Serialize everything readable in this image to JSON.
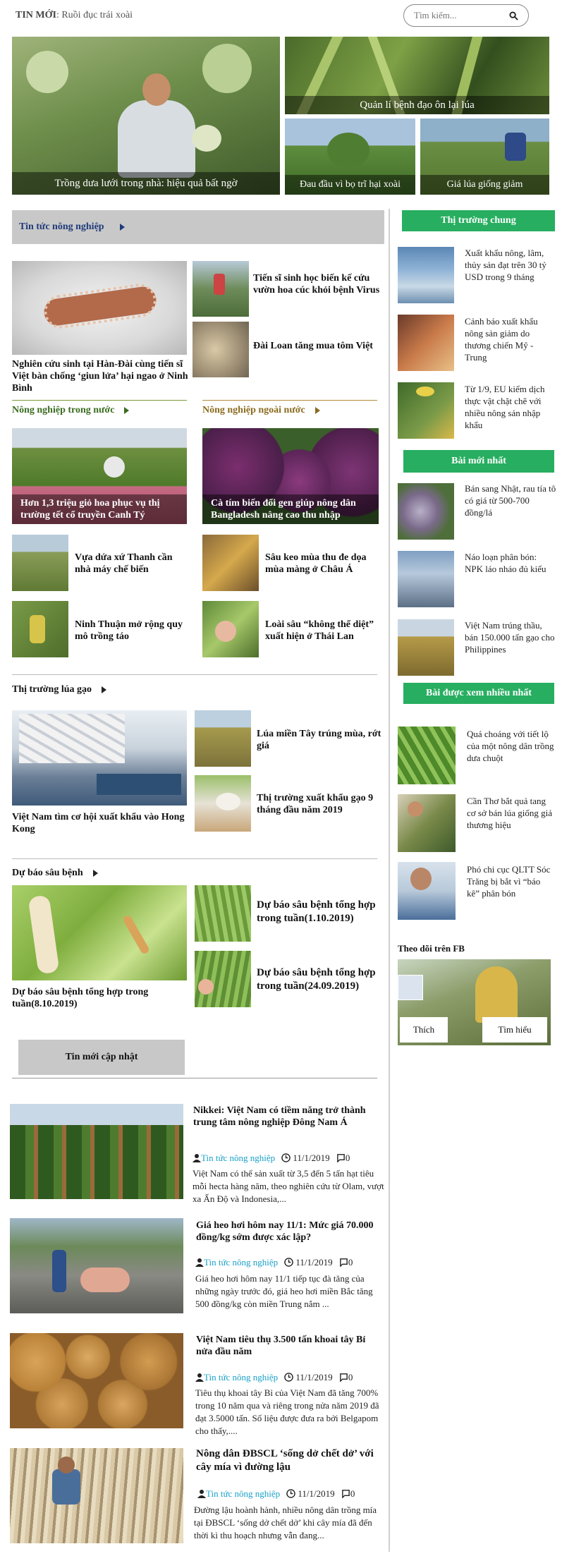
{
  "header": {
    "label": "TIN MỚI",
    "ticker": ": Ruồi đục trái xoài",
    "search_placeholder": "Tìm kiếm..."
  },
  "hero": {
    "main": "Trồng dưa lưới trong nhà: hiệu quả bất ngờ",
    "top_right": "Quản lí bệnh đạo ôn lại lúa",
    "bottom_mid": "Đau đầu vì bọ trĩ hại xoài",
    "bottom_right": "Giá lúa giống giảm"
  },
  "main": {
    "section_title": "Tin tức nông nghiệp",
    "feature": "Nghiên cứu sinh tại Hàn-Đài cùng tiến sĩ Việt bàn chống ‘giun lửa’ hại ngao ở Ninh Bình",
    "side": [
      "Tiến sĩ sinh học biến kế cứu vườn hoa cúc khỏi bệnh Virus",
      "Đài Loan tăng mua tôm Việt"
    ],
    "domestic": {
      "title": "Nông nghiệp trong nước",
      "feature": "Hơn 1,3 triệu giỏ hoa phục vụ thị trường tết cổ truyền Canh Tý",
      "items": [
        "Vựa dứa xứ Thanh cần nhà máy chế biến",
        "Ninh Thuận mở rộng quy mô trồng táo"
      ]
    },
    "foreign": {
      "title": "Nông nghiệp ngoài nước",
      "feature": "Cà tím biến đổi gen giúp nông dân Bangladesh nâng cao thu nhập",
      "items": [
        "Sâu keo mùa thu đe dọa mùa màng ở Châu Á",
        "Loài sâu “không thể diệt” xuất hiện ở Thái Lan"
      ]
    },
    "rice": {
      "title": "Thị trường lúa gạo",
      "feature": "Việt Nam tìm cơ hội xuất khẩu vào Hong Kong",
      "items": [
        "Lúa miền Tây trúng mùa, rớt giá",
        "Thị trường xuất khẩu gạo 9 tháng đầu năm 2019"
      ]
    },
    "pest": {
      "title": "Dự báo sâu bệnh",
      "feature": "Dự báo sâu bệnh tổng hợp trong tuần(8.10.2019)",
      "items": [
        "Dự báo sâu bệnh tổng hợp trong tuần(1.10.2019)",
        "Dự báo sâu bệnh tổng hợp trong tuần(24.09.2019)"
      ]
    },
    "update_button": "Tin mới cập nhật"
  },
  "latest": [
    {
      "title": "Nikkei: Việt Nam có tiềm năng trở thành trung tâm nông nghiệp Đông Nam Á",
      "cat": "Tin tức nông nghiệp",
      "date": "11/1/2019",
      "comments": "0",
      "summary": "Việt Nam có thể sản xuất từ 3,5 đến 5 tấn hạt tiêu mỗi hecta hàng năm, theo nghiên cứu từ Olam, vượt xa Ấn Độ và Indonesia,..."
    },
    {
      "title": "Giá heo hơi hôm nay 11/1: Mức giá 70.000 đồng/kg sớm được xác lập?",
      "cat": "Tin tức nông nghiệp",
      "date": "11/1/2019",
      "comments": "0",
      "summary": "Giá heo hơi hôm nay 11/1 tiếp tục đà tăng của những ngày trước đó, giá heo hơi miền Bắc tăng 500 đồng/kg còn miền Trung nắm ..."
    },
    {
      "title": "Việt Nam tiêu thụ 3.500 tấn khoai tây Bỉ nửa đầu năm",
      "cat": "Tin tức nông nghiệp",
      "date": "11/1/2019",
      "comments": "0",
      "summary": "Tiêu thụ khoai tây Bỉ của Việt Nam đã tăng 700% trong 10 năm qua và riêng trong nửa năm 2019 đã đạt 3.5000 tấn. Số liệu được đưa ra bởi Belgapom cho thấy,...."
    },
    {
      "title": "Nông dân ĐBSCL ‘sống dở chết dở’ với cây mía vì đường lậu",
      "cat": "Tin tức nông nghiệp",
      "date": "11/1/2019",
      "comments": "0",
      "summary": "Đường lậu hoành hành, nhiều nông dân trồng mía tại ĐBSCL ‘sống dở chết dở’ khi cây mía đã đến thời kì thu hoạch nhưng vẫn đang..."
    }
  ],
  "sidebar": {
    "market_title": "Thị trường chung",
    "market": [
      "Xuất khẩu nông, lâm, thủy sản đạt trên 30 tỷ USD trong 9 tháng",
      "Cảnh báo xuất khẩu nông sản giảm do thương chiến Mỹ - Trung",
      "Từ 1/9, EU kiểm dịch thực vật chặt chẽ với nhiều nông sản nhập khẩu"
    ],
    "latest_title": "Bài mới nhất",
    "latest": [
      "Bán sang Nhật, rau tía tô có giá từ 500-700 đồng/lá",
      "Náo loạn phân bón: NPK láo nháo đủ kiểu",
      "Việt Nam trúng thầu, bán 150.000 tấn gạo cho Philippines"
    ],
    "popular_title": "Bài được xem nhiều nhất",
    "popular": [
      "Quá choáng với tiết lộ của một nông dân trồng dưa chuột",
      "Cần Thơ bắt quả tang cơ sở bán lúa giống giả thương hiệu",
      "Phó chi cục QLTT Sóc Trăng bị bắt vì “báo kê” phân bón"
    ],
    "fb_title": "Theo dõi trên FB",
    "fb_like": "Thích",
    "fb_more": "Tìm hiểu"
  }
}
